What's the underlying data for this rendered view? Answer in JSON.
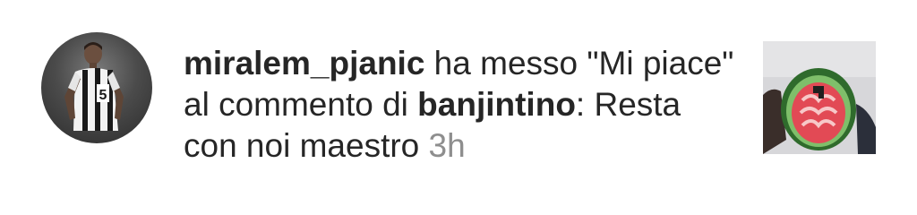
{
  "notification": {
    "actor_username": "miralem_pjanic",
    "action_text": " ha messo \"Mi piace\" al commento di ",
    "target_username": "banjintino",
    "separator": ":",
    "comment_text": "Resta con noi maestro",
    "timestamp": "3h",
    "avatar_icon": "user-avatar-icon",
    "thumbnail_icon": "post-thumbnail-icon"
  },
  "colors": {
    "primary_text": "#262626",
    "secondary_text": "#8e8e8e",
    "background": "#ffffff"
  }
}
